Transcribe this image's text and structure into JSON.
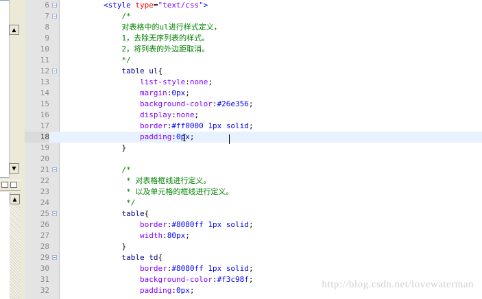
{
  "colors": {
    "tag": "#0000ff",
    "attr": "#ff0000",
    "value": "#8000ff",
    "comment": "#008000",
    "selector": "#000080",
    "property": "#8000ff",
    "number": "#0000ff",
    "punct": "#000000",
    "text": "#000000"
  },
  "icons": {
    "scroll_up": "triangle-up-icon",
    "scroll_down": "triangle-down-icon"
  },
  "scroll": {
    "up": "▲",
    "down": "▼"
  },
  "watermark": "http://blog.csdn.net/lovewaterman",
  "lines": [
    {
      "n": "6",
      "fold": true,
      "indent": "        ",
      "tokens": [
        [
          "<style ",
          "tag"
        ],
        [
          "type",
          "attr"
        ],
        [
          "=",
          "punct"
        ],
        [
          "\"text/css\"",
          "value"
        ],
        [
          ">",
          "tag"
        ]
      ]
    },
    {
      "n": "7",
      "fold": true,
      "indent": "            ",
      "tokens": [
        [
          "/*",
          "comment"
        ]
      ]
    },
    {
      "n": "8",
      "indent": "            ",
      "tokens": [
        [
          "对表格中的ul进行样式定义，",
          "comment"
        ]
      ]
    },
    {
      "n": "9",
      "indent": "            ",
      "tokens": [
        [
          "1，去除无序列表的样式。",
          "comment"
        ]
      ]
    },
    {
      "n": "10",
      "indent": "            ",
      "tokens": [
        [
          "2，将列表的外边距取消。",
          "comment"
        ]
      ]
    },
    {
      "n": "11",
      "indent": "            ",
      "tokens": [
        [
          "*/",
          "comment"
        ]
      ]
    },
    {
      "n": "12",
      "fold": true,
      "indent": "            ",
      "tokens": [
        [
          "table ul",
          "selector"
        ],
        [
          "{",
          "punct"
        ]
      ]
    },
    {
      "n": "13",
      "indent": "                ",
      "tokens": [
        [
          "list-style",
          "property"
        ],
        [
          ":",
          "punct"
        ],
        [
          "none",
          "value"
        ],
        [
          ";",
          "punct"
        ]
      ]
    },
    {
      "n": "14",
      "indent": "                ",
      "tokens": [
        [
          "margin",
          "property"
        ],
        [
          ":",
          "punct"
        ],
        [
          "0px",
          "number"
        ],
        [
          ";",
          "punct"
        ]
      ]
    },
    {
      "n": "15",
      "indent": "                ",
      "tokens": [
        [
          "background-color",
          "property"
        ],
        [
          ":",
          "punct"
        ],
        [
          "#26e356",
          "number"
        ],
        [
          ";",
          "punct"
        ]
      ]
    },
    {
      "n": "16",
      "indent": "                ",
      "tokens": [
        [
          "display",
          "property"
        ],
        [
          ":",
          "punct"
        ],
        [
          "none",
          "value"
        ],
        [
          ";",
          "punct"
        ]
      ]
    },
    {
      "n": "17",
      "indent": "                ",
      "tokens": [
        [
          "border",
          "property"
        ],
        [
          ":",
          "punct"
        ],
        [
          "#ff0000 1px solid",
          "number"
        ],
        [
          ";",
          "punct"
        ]
      ]
    },
    {
      "n": "18",
      "current": true,
      "indent": "                ",
      "tokens": [
        [
          "padding",
          "property"
        ],
        [
          ":",
          "punct"
        ],
        [
          "0px",
          "number"
        ],
        [
          ";",
          "punct"
        ]
      ]
    },
    {
      "n": "19",
      "indent": "            ",
      "tokens": [
        [
          "}",
          "punct"
        ]
      ]
    },
    {
      "n": "20",
      "indent": "",
      "tokens": []
    },
    {
      "n": "21",
      "fold": true,
      "indent": "            ",
      "tokens": [
        [
          "/*",
          "comment"
        ]
      ]
    },
    {
      "n": "22",
      "indent": "             ",
      "tokens": [
        [
          "* 对表格框线进行定义。",
          "comment"
        ]
      ]
    },
    {
      "n": "23",
      "indent": "             ",
      "tokens": [
        [
          "* 以及单元格的框线进行定义。",
          "comment"
        ]
      ]
    },
    {
      "n": "24",
      "indent": "             ",
      "tokens": [
        [
          "*/",
          "comment"
        ]
      ]
    },
    {
      "n": "25",
      "fold": true,
      "indent": "            ",
      "tokens": [
        [
          "table",
          "selector"
        ],
        [
          "{",
          "punct"
        ]
      ]
    },
    {
      "n": "26",
      "indent": "                ",
      "tokens": [
        [
          "border",
          "property"
        ],
        [
          ":",
          "punct"
        ],
        [
          "#8080ff 1px solid",
          "number"
        ],
        [
          ";",
          "punct"
        ]
      ]
    },
    {
      "n": "27",
      "indent": "                ",
      "tokens": [
        [
          "width",
          "property"
        ],
        [
          ":",
          "punct"
        ],
        [
          "80px",
          "number"
        ],
        [
          ";",
          "punct"
        ]
      ]
    },
    {
      "n": "28",
      "indent": "            ",
      "tokens": [
        [
          "}",
          "punct"
        ]
      ]
    },
    {
      "n": "29",
      "fold": true,
      "indent": "            ",
      "tokens": [
        [
          "table td",
          "selector"
        ],
        [
          "{",
          "punct"
        ]
      ]
    },
    {
      "n": "30",
      "indent": "                ",
      "tokens": [
        [
          "border",
          "property"
        ],
        [
          ":",
          "punct"
        ],
        [
          "#8080ff 1px solid",
          "number"
        ],
        [
          ";",
          "punct"
        ]
      ]
    },
    {
      "n": "31",
      "indent": "                ",
      "tokens": [
        [
          "background-color",
          "property"
        ],
        [
          ":",
          "punct"
        ],
        [
          "#f3c98f",
          "number"
        ],
        [
          ";",
          "punct"
        ]
      ]
    },
    {
      "n": "32",
      "indent": "                ",
      "tokens": [
        [
          "padding",
          "property"
        ],
        [
          ":",
          "punct"
        ],
        [
          "0px",
          "number"
        ],
        [
          ";",
          "punct"
        ]
      ]
    }
  ]
}
